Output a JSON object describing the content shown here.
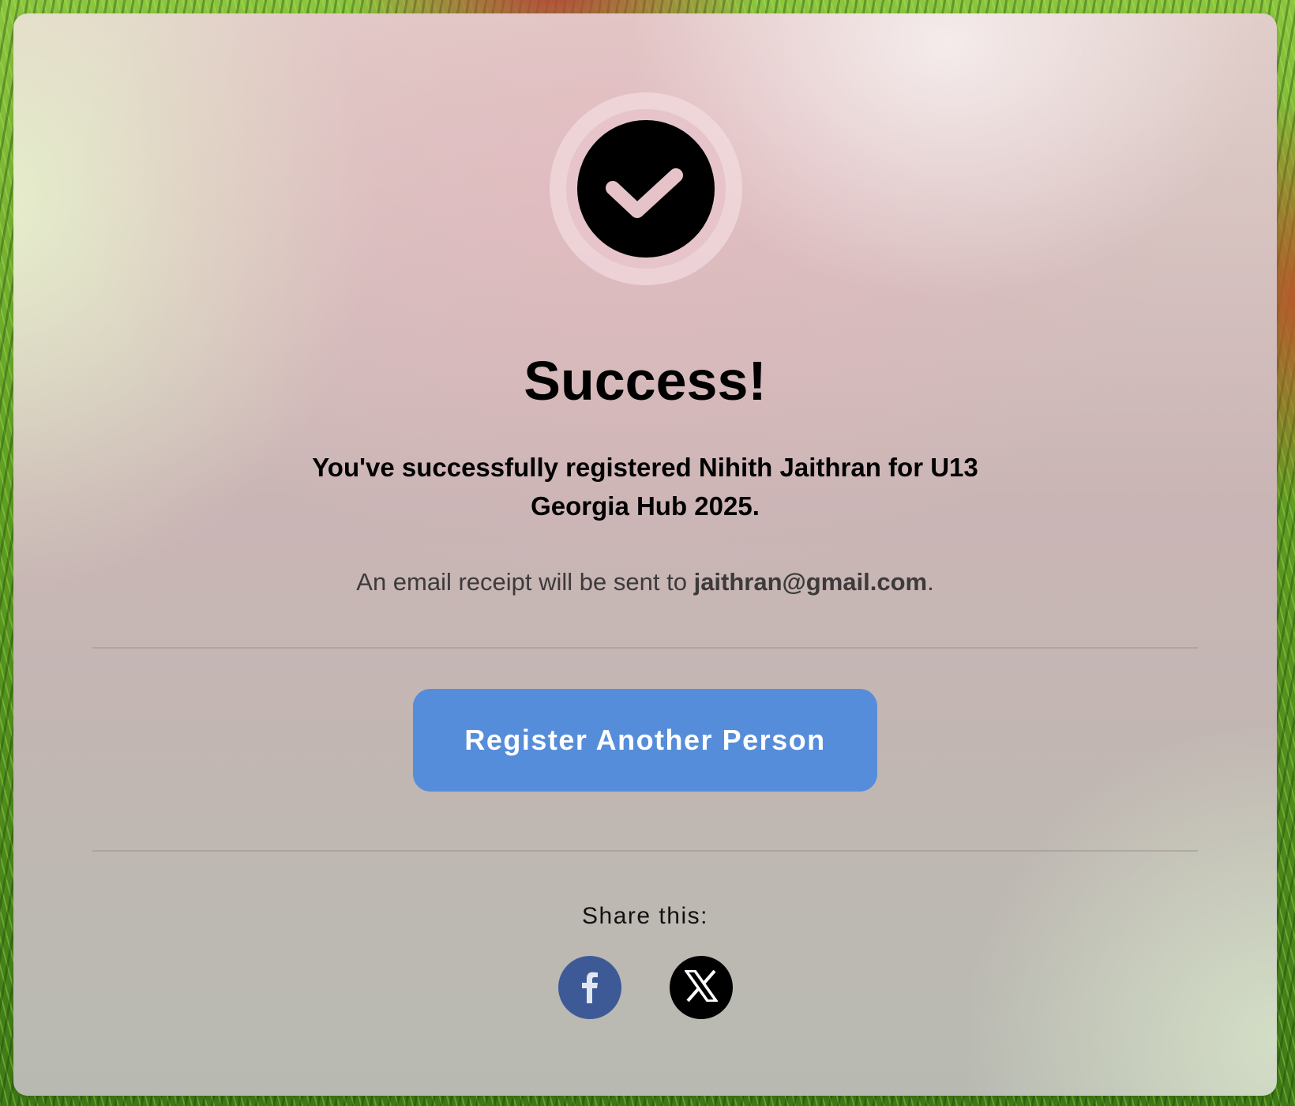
{
  "confirmation": {
    "title": "Success!",
    "message": "You've successfully registered Nihith Jaithran for U13 Georgia Hub 2025.",
    "receipt_prefix": "An email receipt will be sent to ",
    "email": "jaithran@gmail.com",
    "receipt_suffix": "."
  },
  "actions": {
    "register_another_label": "Register Another Person"
  },
  "share": {
    "label": "Share this:",
    "buttons": [
      {
        "network": "facebook",
        "icon": "facebook-icon",
        "color": "#3d5a96"
      },
      {
        "network": "x",
        "icon": "x-icon",
        "color": "#000000"
      }
    ]
  },
  "colors": {
    "accent": "#568dda",
    "check_circle": "#000000",
    "check_mark": "#e6c3c8"
  }
}
